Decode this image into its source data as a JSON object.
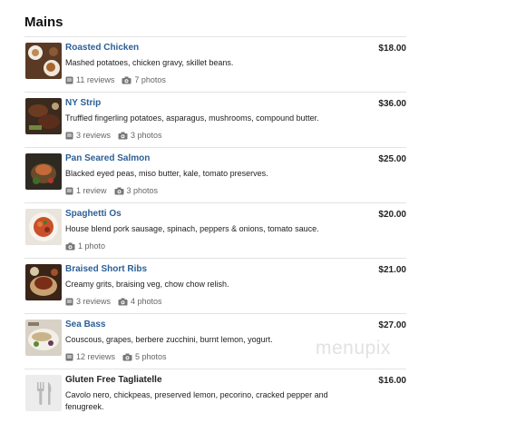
{
  "section": {
    "title": "Mains"
  },
  "watermark": "menupix",
  "items": [
    {
      "name": "Roasted Chicken",
      "description": "Mashed potatoes, chicken gravy, skillet beans.",
      "price": "$18.00",
      "reviews": "11 reviews",
      "photos": "7 photos"
    },
    {
      "name": "NY Strip",
      "description": "Truffled fingerling potatoes, asparagus, mushrooms, compound butter.",
      "price": "$36.00",
      "reviews": "3 reviews",
      "photos": "3 photos"
    },
    {
      "name": "Pan Seared Salmon",
      "description": "Blacked eyed peas, miso butter, kale, tomato preserves.",
      "price": "$25.00",
      "reviews": "1 review",
      "photos": "3 photos"
    },
    {
      "name": "Spaghetti Os",
      "description": "House blend pork sausage, spinach, peppers & onions, tomato sauce.",
      "price": "$20.00",
      "reviews": "",
      "photos": "1 photo"
    },
    {
      "name": "Braised Short Ribs",
      "description": "Creamy grits, braising veg, chow chow relish.",
      "price": "$21.00",
      "reviews": "3 reviews",
      "photos": "4 photos"
    },
    {
      "name": "Sea Bass",
      "description": "Couscous, grapes, berbere zucchini, burnt lemon, yogurt.",
      "price": "$27.00",
      "reviews": "12 reviews",
      "photos": "5 photos"
    },
    {
      "name": "Gluten Free Tagliatelle",
      "description": "Cavolo nero, chickpeas, preserved lemon, pecorino, cracked pepper and fenugreek.",
      "price": "$16.00",
      "reviews": "",
      "photos": ""
    }
  ],
  "colors": {
    "link": "#2c5f97",
    "divider": "#e2e2e2",
    "meta": "#666666"
  }
}
